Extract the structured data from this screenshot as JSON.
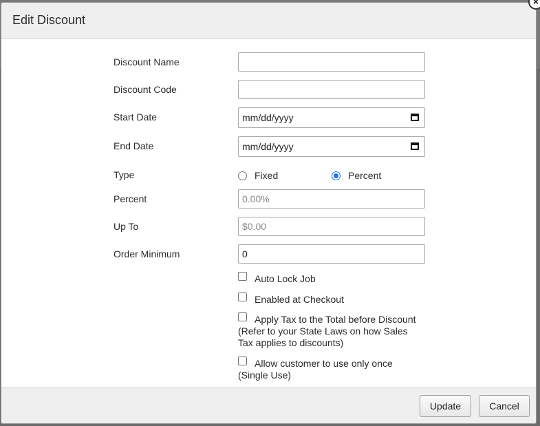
{
  "dialog": {
    "title": "Edit Discount",
    "close_glyph": "×"
  },
  "form": {
    "discount_name": {
      "label": "Discount Name",
      "value": "",
      "placeholder": ""
    },
    "discount_code": {
      "label": "Discount Code",
      "value": "",
      "placeholder": ""
    },
    "start_date": {
      "label": "Start Date",
      "display": "mm/dd/yyyy"
    },
    "end_date": {
      "label": "End Date",
      "display": "mm/dd/yyyy"
    },
    "type": {
      "label": "Type",
      "options": [
        {
          "label": "Fixed",
          "checked": false
        },
        {
          "label": "Percent",
          "checked": true
        }
      ]
    },
    "percent": {
      "label": "Percent",
      "value": "",
      "placeholder": "0.00%"
    },
    "up_to": {
      "label": "Up To",
      "value": "",
      "placeholder": "$0.00"
    },
    "order_minimum": {
      "label": "Order Minimum",
      "value": "0",
      "placeholder": ""
    },
    "checkboxes": [
      {
        "label": "Auto Lock Job",
        "sub": "",
        "checked": false
      },
      {
        "label": "Enabled at Checkout",
        "sub": "",
        "checked": false
      },
      {
        "label": "Apply Tax to the Total before Discount",
        "sub": "(Refer to your State Laws on how Sales Tax applies to discounts)",
        "checked": false
      },
      {
        "label": "Allow customer to use only once",
        "sub": "(Single Use)",
        "checked": false
      }
    ]
  },
  "footer": {
    "update_label": "Update",
    "cancel_label": "Cancel"
  }
}
